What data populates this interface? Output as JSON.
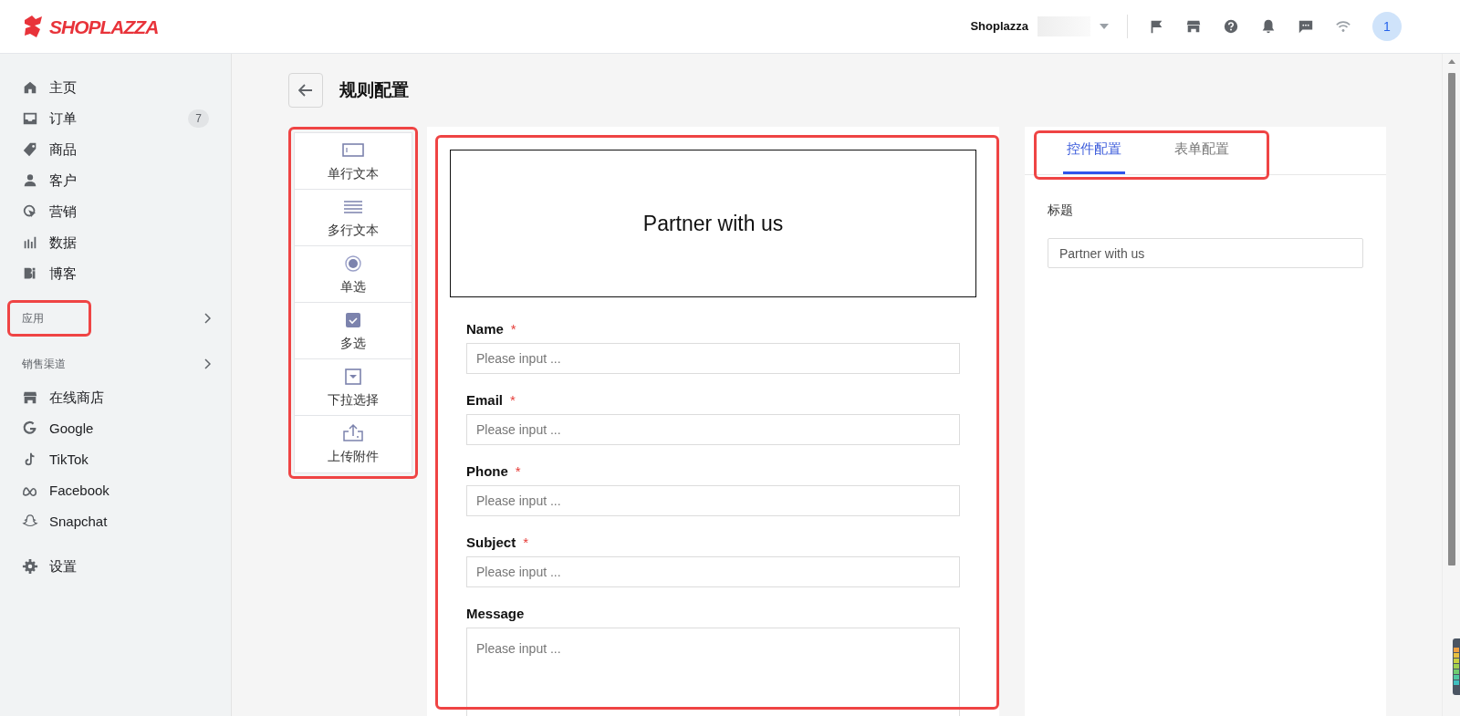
{
  "header": {
    "logo": "SHOPLAZZA",
    "store_name": "Shoplazza",
    "avatar": "1"
  },
  "sidebar": {
    "items": [
      {
        "label": "主页"
      },
      {
        "label": "订单",
        "badge": "7"
      },
      {
        "label": "商品"
      },
      {
        "label": "客户"
      },
      {
        "label": "营销"
      },
      {
        "label": "数据"
      },
      {
        "label": "博客"
      }
    ],
    "apps_section": {
      "label": "应用",
      "highlighted": true
    },
    "sales_channels": {
      "label": "销售渠道",
      "items": [
        {
          "label": "在线商店"
        },
        {
          "label": "Google"
        },
        {
          "label": "TikTok"
        },
        {
          "label": "Facebook"
        },
        {
          "label": "Snapchat"
        }
      ]
    },
    "settings": {
      "label": "设置"
    }
  },
  "page": {
    "title": "规则配置"
  },
  "palette": {
    "highlighted": true,
    "items": [
      {
        "label": "单行文本"
      },
      {
        "label": "多行文本"
      },
      {
        "label": "单选"
      },
      {
        "label": "多选"
      },
      {
        "label": "下拉选择"
      },
      {
        "label": "上传附件"
      }
    ]
  },
  "form": {
    "highlighted": true,
    "heading": "Partner with us",
    "fields": [
      {
        "kind": "text",
        "label": "Name",
        "required_mark": "*",
        "placeholder": "Please input ..."
      },
      {
        "kind": "text",
        "label": "Email",
        "required_mark": "*",
        "placeholder": "Please input ..."
      },
      {
        "kind": "text",
        "label": "Phone",
        "required_mark": "*",
        "placeholder": "Please input ..."
      },
      {
        "kind": "text",
        "label": "Subject",
        "required_mark": "*",
        "placeholder": "Please input ..."
      },
      {
        "kind": "textarea",
        "label": "Message",
        "placeholder": "Please input ..."
      }
    ]
  },
  "settings_panel": {
    "tabs_highlighted": true,
    "tabs": [
      {
        "label": "控件配置",
        "selected": true
      },
      {
        "label": "表单配置",
        "selected": false
      }
    ],
    "title_field": {
      "label": "标题",
      "value": "Partner with us"
    }
  }
}
